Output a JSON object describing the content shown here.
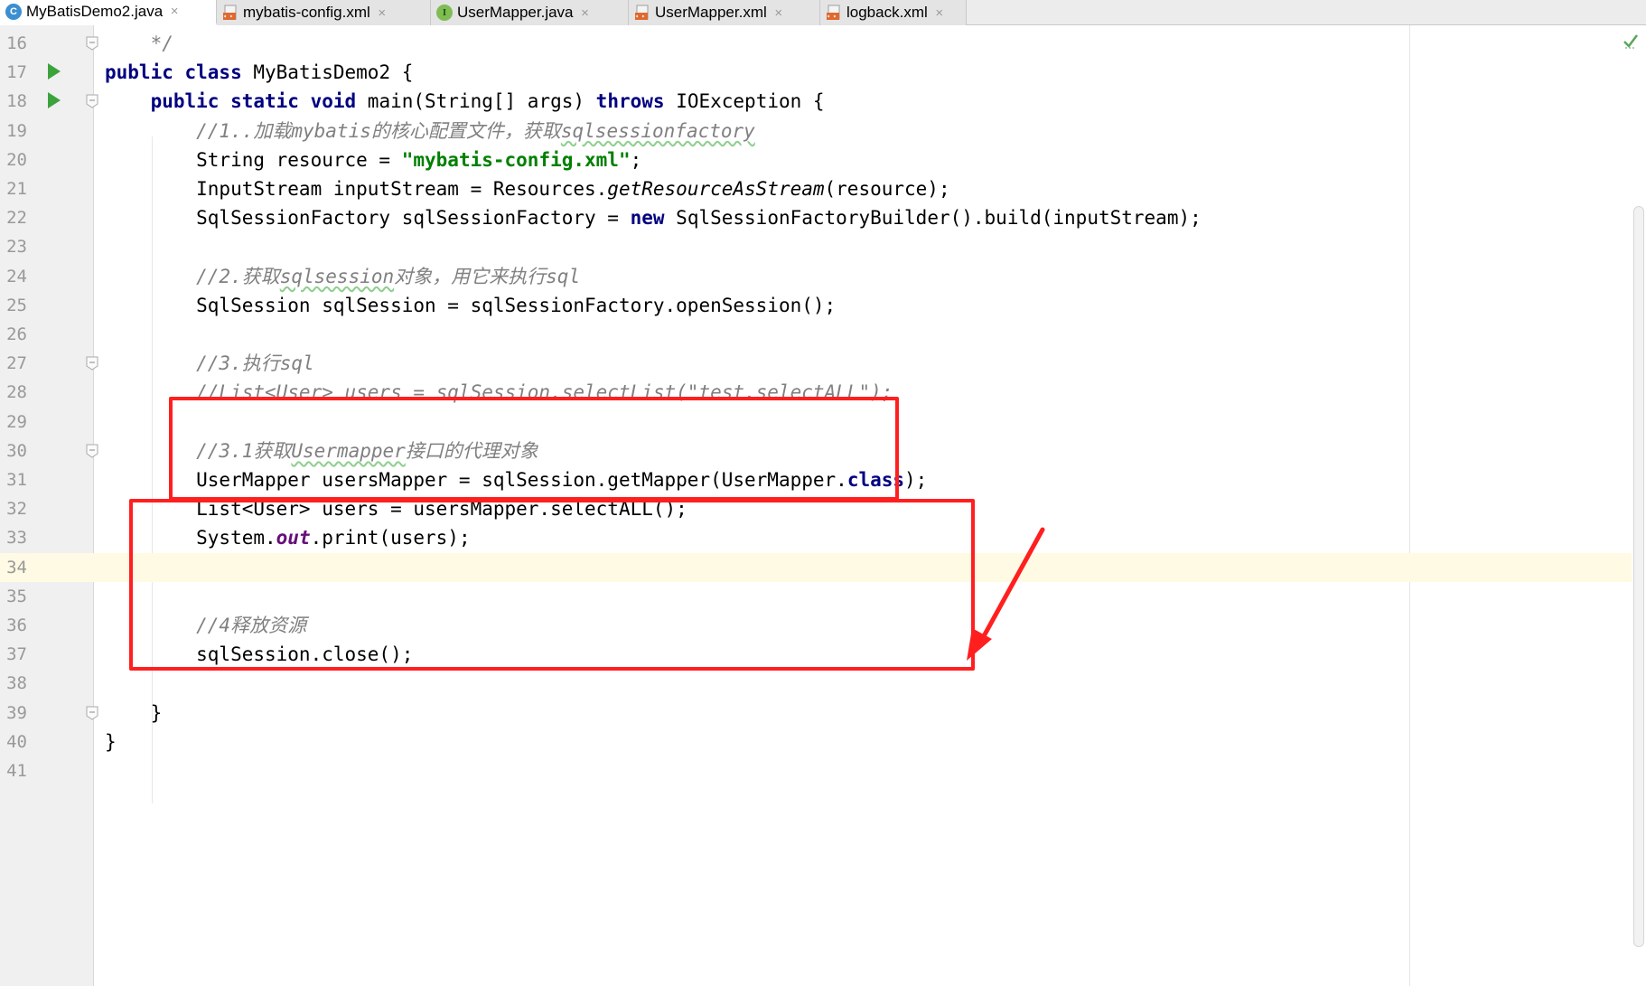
{
  "tabs": [
    {
      "label": "MyBatisDemo2.java",
      "icon": "java-class-icon",
      "active": true
    },
    {
      "label": "mybatis-config.xml",
      "icon": "xml-file-icon",
      "active": false
    },
    {
      "label": "UserMapper.java",
      "icon": "java-interface-icon",
      "active": false
    },
    {
      "label": "UserMapper.xml",
      "icon": "xml-file-icon",
      "active": false
    },
    {
      "label": "logback.xml",
      "icon": "xml-file-icon",
      "active": false
    }
  ],
  "tab_close_glyph": "×",
  "class_icon_letter": "C",
  "interface_icon_letter": "I",
  "editor": {
    "current_line": "34",
    "lines": [
      {
        "num": "16",
        "t": [
          {
            "c": "cmt",
            "s": "    */"
          }
        ]
      },
      {
        "num": "17",
        "t": [
          {
            "c": "kw",
            "s": "public class "
          },
          {
            "c": "",
            "s": "MyBatisDemo2 {"
          }
        ]
      },
      {
        "num": "18",
        "t": [
          {
            "c": "",
            "s": "    "
          },
          {
            "c": "kw",
            "s": "public static void "
          },
          {
            "c": "",
            "s": "main(String[] args) "
          },
          {
            "c": "kw",
            "s": "throws "
          },
          {
            "c": "",
            "s": "IOException {"
          }
        ]
      },
      {
        "num": "19",
        "t": [
          {
            "c": "cmt",
            "s": "        //1..加载mybatis的核心配置文件，获取"
          },
          {
            "c": "cmt squiggle",
            "s": "sqlsessionfactory"
          }
        ]
      },
      {
        "num": "20",
        "t": [
          {
            "c": "",
            "s": "        String resource = "
          },
          {
            "c": "str",
            "s": "\"mybatis-config.xml\""
          },
          {
            "c": "",
            "s": ";"
          }
        ]
      },
      {
        "num": "21",
        "t": [
          {
            "c": "",
            "s": "        InputStream inputStream = Resources."
          },
          {
            "c": "smethod",
            "s": "getResourceAsStream"
          },
          {
            "c": "",
            "s": "(resource);"
          }
        ]
      },
      {
        "num": "22",
        "t": [
          {
            "c": "",
            "s": "        SqlSessionFactory sqlSessionFactory = "
          },
          {
            "c": "kw",
            "s": "new "
          },
          {
            "c": "",
            "s": "SqlSessionFactoryBuilder().build(inputStream);"
          }
        ]
      },
      {
        "num": "23",
        "t": []
      },
      {
        "num": "24",
        "t": [
          {
            "c": "cmt",
            "s": "        //2.获取"
          },
          {
            "c": "cmt squiggle",
            "s": "sqlsession"
          },
          {
            "c": "cmt",
            "s": "对象，用它来执行sql"
          }
        ]
      },
      {
        "num": "25",
        "t": [
          {
            "c": "",
            "s": "        SqlSession sqlSession = sqlSessionFactory.openSession();"
          }
        ]
      },
      {
        "num": "26",
        "t": []
      },
      {
        "num": "27",
        "t": [
          {
            "c": "cmt",
            "s": "        //3.执行sql"
          }
        ]
      },
      {
        "num": "28",
        "t": [
          {
            "c": "cmt",
            "s": "        //List<User> users = sqlSession.selectList(\"test.selectALL\");"
          }
        ]
      },
      {
        "num": "29",
        "t": []
      },
      {
        "num": "30",
        "t": [
          {
            "c": "cmt",
            "s": "        //3.1获取"
          },
          {
            "c": "cmt squiggle",
            "s": "Usermapper"
          },
          {
            "c": "cmt",
            "s": "接口的代理对象"
          }
        ]
      },
      {
        "num": "31",
        "t": [
          {
            "c": "",
            "s": "        UserMapper usersMapper = sqlSession.getMapper(UserMapper."
          },
          {
            "c": "kw",
            "s": "class"
          },
          {
            "c": "",
            "s": ");"
          }
        ]
      },
      {
        "num": "32",
        "t": [
          {
            "c": "",
            "s": "        List<User> users = usersMapper.selectALL();"
          }
        ]
      },
      {
        "num": "33",
        "t": [
          {
            "c": "",
            "s": "        System."
          },
          {
            "c": "sfield",
            "s": "out"
          },
          {
            "c": "",
            "s": ".print(users);"
          }
        ]
      },
      {
        "num": "34",
        "t": []
      },
      {
        "num": "35",
        "t": []
      },
      {
        "num": "36",
        "t": [
          {
            "c": "cmt",
            "s": "        //4释放资源"
          }
        ]
      },
      {
        "num": "37",
        "t": [
          {
            "c": "",
            "s": "        sqlSession.close();"
          }
        ]
      },
      {
        "num": "38",
        "t": []
      },
      {
        "num": "39",
        "t": [
          {
            "c": "",
            "s": "    }"
          }
        ]
      },
      {
        "num": "40",
        "t": [
          {
            "c": "",
            "s": "}"
          }
        ]
      },
      {
        "num": "41",
        "t": []
      }
    ],
    "run_markers": [
      "17",
      "18"
    ],
    "fold_markers": [
      "16",
      "18",
      "27",
      "30",
      "39"
    ]
  },
  "colors": {
    "keyword": "#000080",
    "string": "#008000",
    "comment": "#808080",
    "static_field": "#660e7a",
    "current_line": "#fffae3",
    "annotation_red": "#ff1f1f",
    "run_green": "#3ca33c"
  }
}
